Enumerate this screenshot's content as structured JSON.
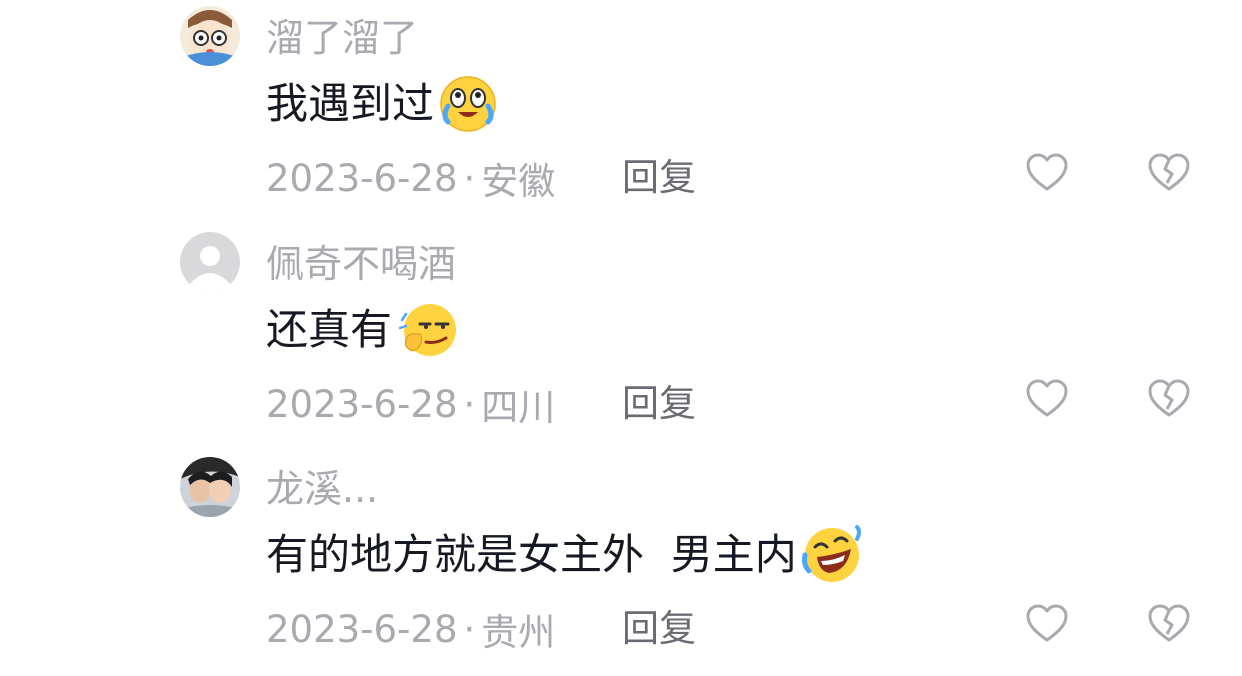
{
  "comments": [
    {
      "username": "溜了溜了",
      "text": "我遇到过",
      "emoji_icon": "tearful-laugh-emoji-icon",
      "date": "2023-6-28",
      "separator": "·",
      "location": "安徽",
      "reply_label": "回复"
    },
    {
      "username": "佩奇不喝酒",
      "text": "还真有",
      "emoji_icon": "smirk-hand-chin-emoji-icon",
      "date": "2023-6-28",
      "separator": "·",
      "location": "四川",
      "reply_label": "回复"
    },
    {
      "username": "龙溪...",
      "text": "有的地方就是女主外  男主内",
      "emoji_icon": "rolling-laugh-emoji-icon",
      "date": "2023-6-28",
      "separator": "·",
      "location": "贵州",
      "reply_label": "回复"
    }
  ],
  "colors": {
    "username": "#a9a9b0",
    "text": "#161823",
    "meta": "#a9a9b0",
    "reply": "#6b6c73",
    "icon_stroke": "#a9a9b0"
  }
}
